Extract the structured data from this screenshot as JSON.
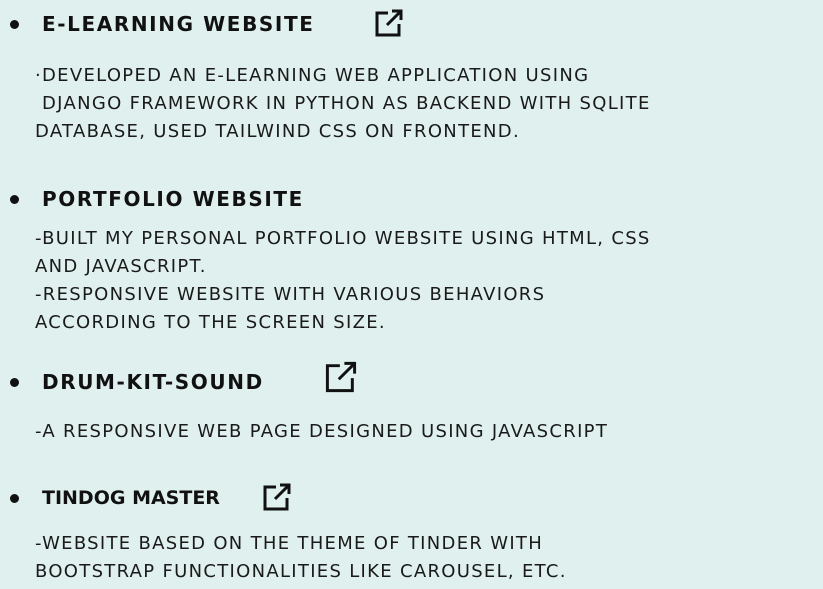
{
  "projects": [
    {
      "title": "E-LEARNING WEBSITE",
      "lines": [
        "·DEVELOPED AN E-LEARNING WEB APPLICATION USING",
        " DJANGO FRAMEWORK IN PYTHON AS BACKEND WITH SQLITE",
        "DATABASE, USED TAILWIND CSS ON FRONTEND."
      ],
      "has_link_icon": true,
      "link_icon": "external-link-icon"
    },
    {
      "title": "PORTFOLIO WEBSITE",
      "lines": [
        "-BUILT MY PERSONAL PORTFOLIO WEBSITE USING HTML, CSS",
        "AND JAVASCRIPT.",
        "-RESPONSIVE WEBSITE WITH VARIOUS BEHAVIORS",
        "ACCORDING TO THE SCREEN SIZE."
      ],
      "has_link_icon": false
    },
    {
      "title": "DRUM-KIT-SOUND",
      "lines": [
        "-A RESPONSIVE WEB PAGE DESIGNED USING JAVASCRIPT"
      ],
      "has_link_icon": true,
      "link_icon": "external-link-icon"
    },
    {
      "title": "TINDOG MASTER",
      "lines": [
        "-WEBSITE BASED ON THE THEME OF TINDER WITH",
        "BOOTSTRAP FUNCTIONALITIES LIKE CAROUSEL, ETC."
      ],
      "has_link_icon": true,
      "link_icon": "external-link-icon"
    }
  ],
  "colors": {
    "background": "#dff0ef",
    "text": "#111111"
  }
}
